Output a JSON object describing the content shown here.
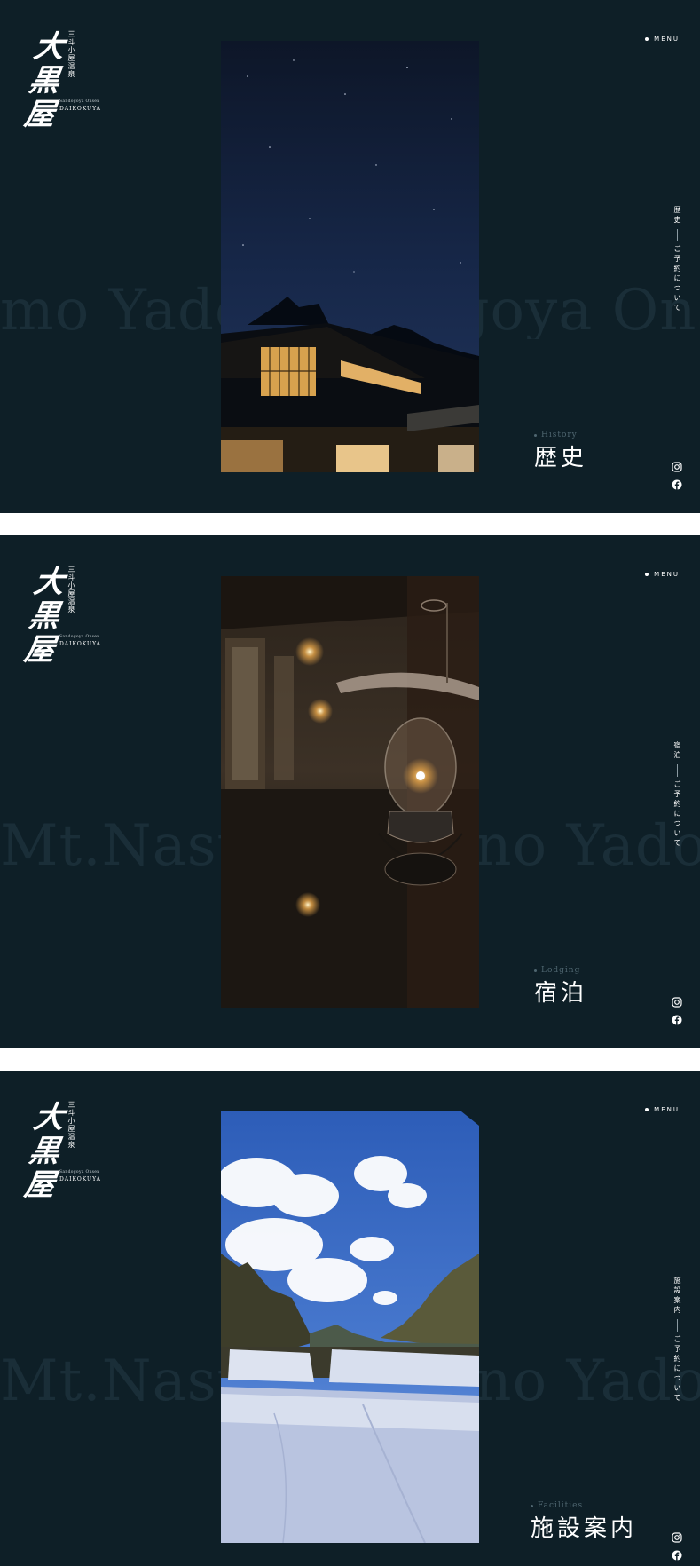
{
  "brand": {
    "logo_kanji": "大黒屋",
    "logo_vertical": "三斗小屋温泉",
    "logo_romaji": "Sandogoya Onsen",
    "logo_name": "DAIKOKUYA"
  },
  "menu_label": "MENU",
  "reservation_link": "ご予約について",
  "icons": {
    "instagram": "instagram-icon",
    "facebook": "facebook-icon"
  },
  "colors": {
    "background": "#0e1f27",
    "text": "#ffffff",
    "muted": "#4f6670",
    "separator": "#ffffff"
  },
  "panels": [
    {
      "bg_text": "mo Yado Sandogoya Onsen",
      "section_en": "History",
      "section_jp": "歴史",
      "side_title": "歴史",
      "photo": "photo-night-lodge"
    },
    {
      "bg_text": "Mt.Nasu Lodge no Yado Sa",
      "section_en": "Lodging",
      "section_jp": "宿泊",
      "side_title": "宿泊",
      "photo": "photo-oil-lamp"
    },
    {
      "bg_text": "Mt.Nasu Lodge no Yado",
      "section_en": "Facilities",
      "section_jp": "施設案内",
      "side_title": "施設案内",
      "photo": "photo-sheets-sky"
    }
  ]
}
